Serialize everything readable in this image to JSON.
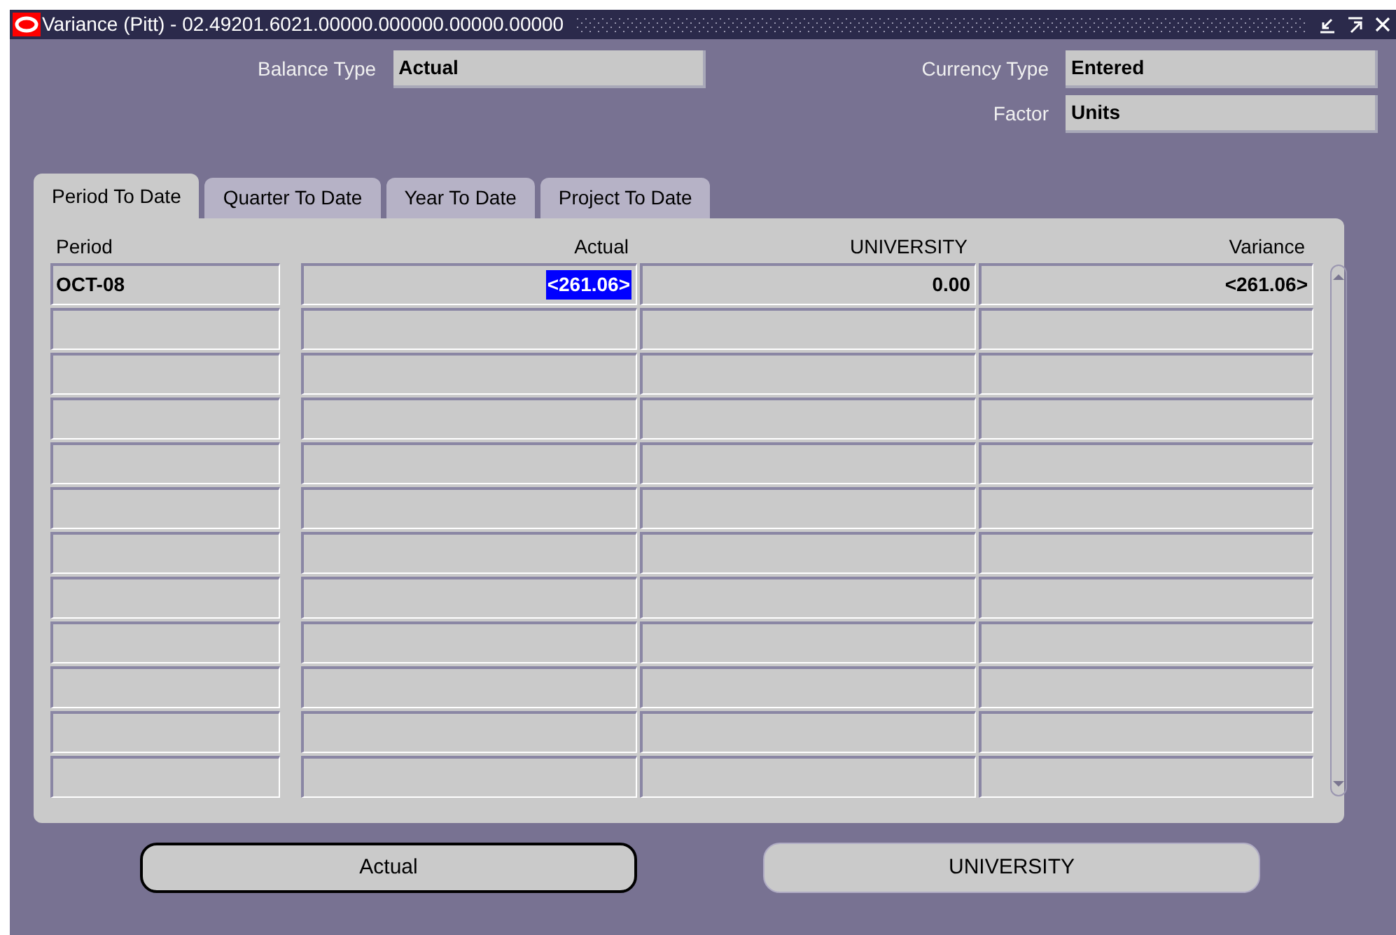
{
  "window": {
    "title": "Variance (Pitt) - 02.49201.6021.00000.000000.00000.00000"
  },
  "fields": [
    {
      "label": "Balance Type",
      "value": "Actual"
    },
    {
      "label": "Currency Type",
      "value": "Entered"
    },
    {
      "label": "Factor",
      "value": "Units"
    }
  ],
  "tabs": [
    {
      "label": "Period To Date",
      "selected": true
    },
    {
      "label": "Quarter To Date",
      "selected": false
    },
    {
      "label": "Year To Date",
      "selected": false
    },
    {
      "label": "Project To Date",
      "selected": false
    }
  ],
  "table": {
    "columns": [
      "Period",
      "Actual",
      "UNIVERSITY",
      "Variance"
    ],
    "rows": [
      {
        "cells": [
          {
            "text": "OCT-08",
            "selected": false
          },
          {
            "text": "<261.06>",
            "selected": true
          },
          {
            "text": "0.00",
            "selected": false
          },
          {
            "text": "<261.06>",
            "selected": false
          }
        ]
      },
      {
        "cells": []
      },
      {
        "cells": []
      },
      {
        "cells": []
      },
      {
        "cells": []
      },
      {
        "cells": []
      },
      {
        "cells": []
      },
      {
        "cells": []
      },
      {
        "cells": []
      },
      {
        "cells": []
      },
      {
        "cells": []
      },
      {
        "cells": []
      }
    ]
  },
  "buttons": [
    {
      "label": "Actual",
      "focused": true
    },
    {
      "label": "UNIVERSITY",
      "focused": false
    }
  ]
}
